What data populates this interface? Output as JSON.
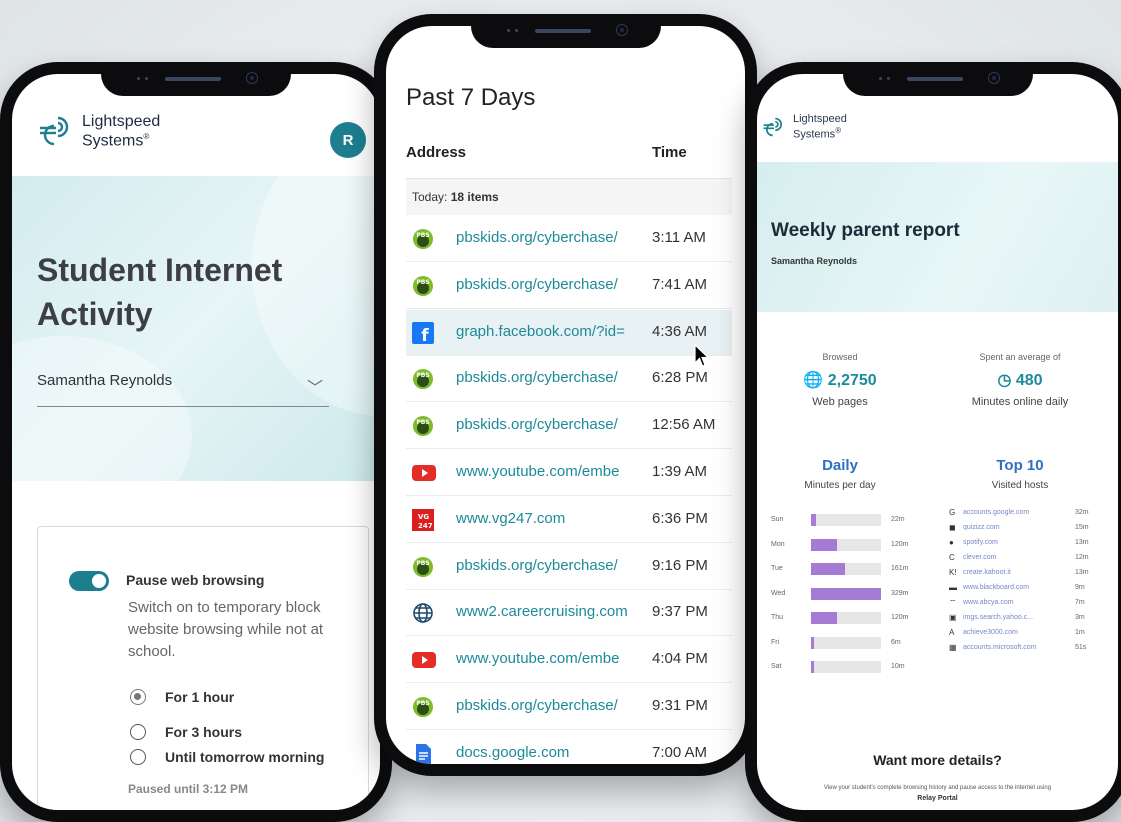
{
  "phone1": {
    "logo": {
      "line1": "Lightspeed",
      "line2": "Systems",
      "reg": "®"
    },
    "avatar_initial": "R",
    "title": "Student Internet Activity",
    "student_select": "Samantha Reynolds",
    "pause": {
      "label": "Pause web browsing",
      "description": "Switch on to temporary block website browsing while not at school.",
      "options": [
        "For 1 hour",
        "For 3 hours",
        "Until tomorrow morning"
      ],
      "selected_index": 0,
      "status": "Paused until 3:12 PM",
      "enabled": true
    }
  },
  "phone2": {
    "title": "Past 7 Days",
    "headers": {
      "address": "Address",
      "time": "Time"
    },
    "today_label": "Today: ",
    "today_count": "18 items",
    "rows": [
      {
        "icon": "pbs-kids-icon",
        "address": "pbskids.org/cyberchase/",
        "time": "3:11 AM"
      },
      {
        "icon": "pbs-kids-icon",
        "address": "pbskids.org/cyberchase/",
        "time": "7:41 AM"
      },
      {
        "icon": "facebook-icon",
        "address": "graph.facebook.com/?id=",
        "time": "4:36 AM"
      },
      {
        "icon": "pbs-kids-icon",
        "address": "pbskids.org/cyberchase/",
        "time": "6:28 PM"
      },
      {
        "icon": "pbs-kids-icon",
        "address": "pbskids.org/cyberchase/",
        "time": "12:56 AM"
      },
      {
        "icon": "youtube-icon",
        "address": "www.youtube.com/embe",
        "time": "1:39 AM"
      },
      {
        "icon": "vg247-icon",
        "address": "www.vg247.com",
        "time": "6:36 PM"
      },
      {
        "icon": "pbs-kids-icon",
        "address": "pbskids.org/cyberchase/",
        "time": "9:16 PM"
      },
      {
        "icon": "globe-icon",
        "address": "www2.careercruising.com",
        "time": "9:37 PM"
      },
      {
        "icon": "youtube-icon",
        "address": "www.youtube.com/embe",
        "time": "4:04 PM"
      },
      {
        "icon": "pbs-kids-icon",
        "address": "pbskids.org/cyberchase/",
        "time": "9:31 PM"
      },
      {
        "icon": "google-docs-icon",
        "address": "docs.google.com",
        "time": "7:00 AM"
      }
    ]
  },
  "phone3": {
    "logo": {
      "line1": "Lightspeed",
      "line2": "Systems",
      "reg": "®"
    },
    "title": "Weekly parent report",
    "student": "Samantha Reynolds",
    "stats": [
      {
        "caption": "Browsed",
        "value": "2,2750",
        "label": "Web pages",
        "icon": "globe-icon"
      },
      {
        "caption": "Spent an average of",
        "value": "480",
        "label": "Minutes online daily",
        "icon": "clock-globe-icon"
      }
    ],
    "daily": {
      "heading": "Daily",
      "sub": "Minutes per day"
    },
    "top10": {
      "heading": "Top 10",
      "sub": "Visited hosts"
    },
    "chart_data": {
      "type": "bar",
      "categories": [
        "Sun",
        "Mon",
        "Tue",
        "Wed",
        "Thu",
        "Fri",
        "Sat"
      ],
      "values": [
        22,
        120,
        161,
        329,
        120,
        6,
        10
      ],
      "value_labels": [
        "22m",
        "120m",
        "161m",
        "329m",
        "120m",
        "6m",
        "10m"
      ],
      "title": "Daily",
      "subtitle": "Minutes per day"
    },
    "hosts": [
      {
        "icon": "google-icon",
        "name": "accounts.google.com",
        "value": "32m"
      },
      {
        "icon": "quizizz-icon",
        "name": "quizizz.com",
        "value": "15m"
      },
      {
        "icon": "spotify-icon",
        "name": "spotify.com",
        "value": "13m"
      },
      {
        "icon": "clever-icon",
        "name": "clever.com",
        "value": "12m"
      },
      {
        "icon": "kahoot-icon",
        "name": "create.kahoot.it",
        "value": "13m"
      },
      {
        "icon": "blackboard-icon",
        "name": "www.blackboard.com",
        "value": "9m"
      },
      {
        "icon": "abcya-icon",
        "name": "www.abcya.com",
        "value": "7m"
      },
      {
        "icon": "yahoo-icon",
        "name": "imgs.search.yahoo.c...",
        "value": "3m"
      },
      {
        "icon": "achieve-icon",
        "name": "achieve3000.com",
        "value": "1m"
      },
      {
        "icon": "microsoft-icon",
        "name": "accounts.microsoft.com",
        "value": "51s"
      }
    ],
    "more_heading": "Want more details?",
    "more_text": "View your student's complete browsing history and pause access to the internet using",
    "more_link": "Relay Portal"
  }
}
